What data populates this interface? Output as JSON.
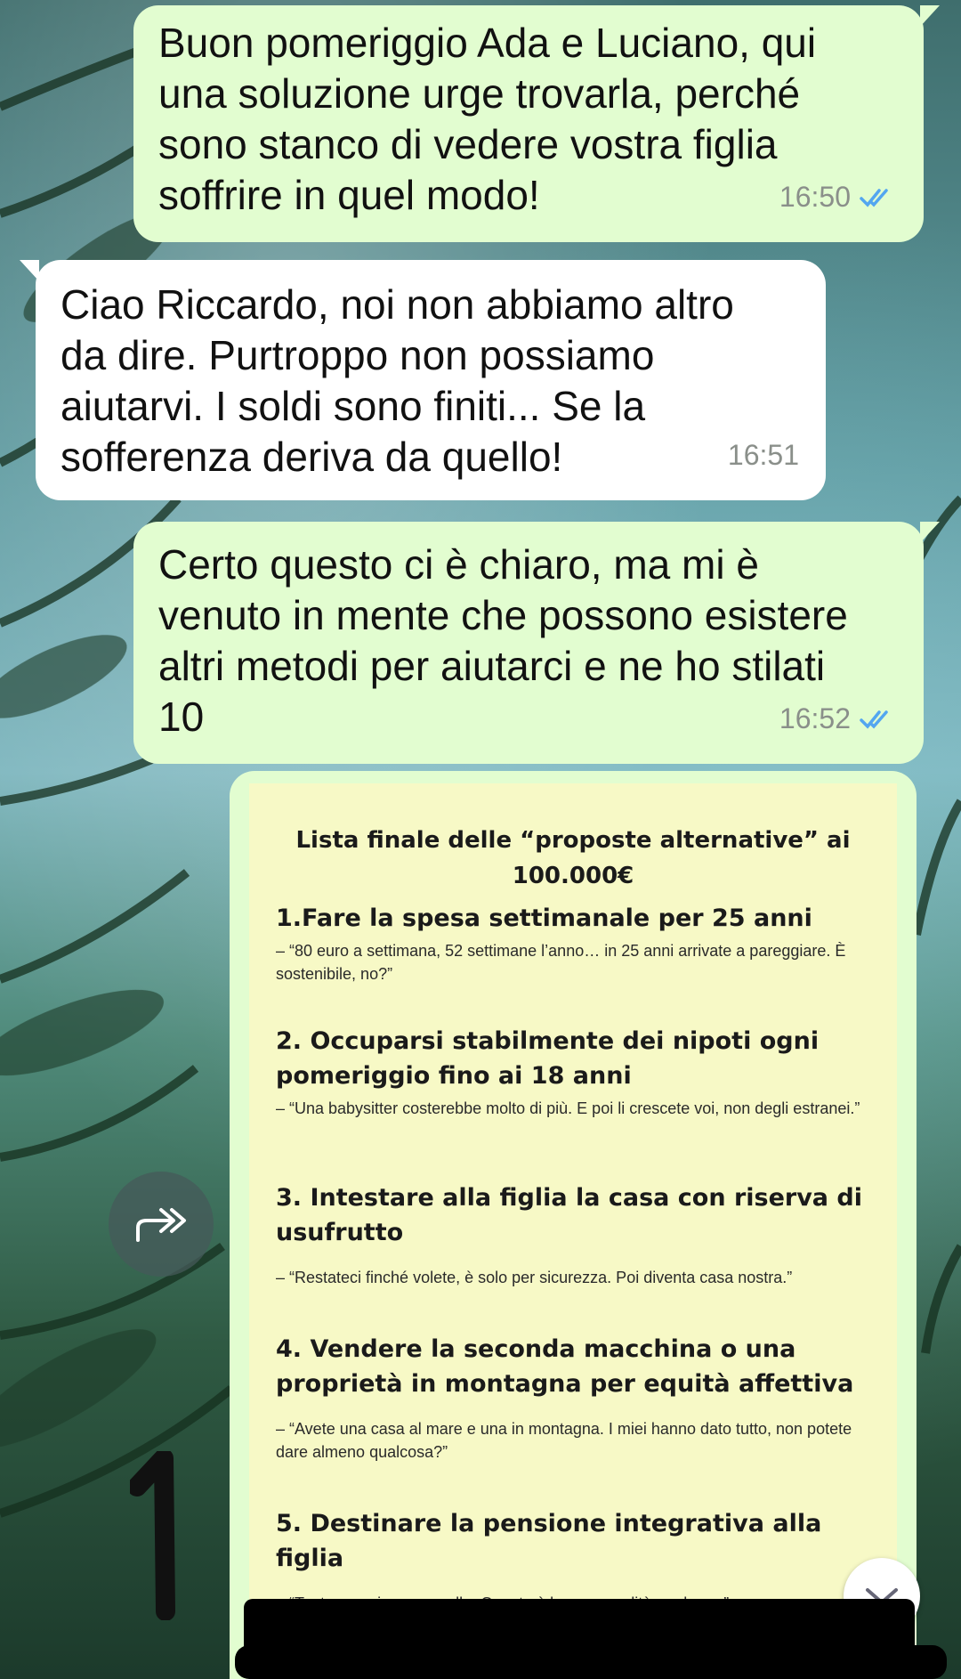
{
  "chat": {
    "messages": [
      {
        "direction": "outgoing",
        "text": "Buon pomeriggio Ada e Luciano, qui\nuna soluzione urge trovarla, perché\nsono stanco di vedere vostra figlia\nsoffrire in quel modo!",
        "time": "16:50",
        "read": true
      },
      {
        "direction": "incoming",
        "text": "Ciao Riccardo, noi non abbiamo altro\nda dire. Purtroppo non possiamo\naiutarvi. I soldi sono finiti... Se la\nsofferenza deriva da quello!",
        "time": "16:51"
      },
      {
        "direction": "outgoing",
        "text": "Certo questo ci è chiaro, ma mi è\nvenuto in mente che possono esistere\naltri metodi per aiutarci e ne ho stilati\n10",
        "time": "16:52",
        "read": true
      }
    ],
    "image_message": {
      "title_line1": "Lista finale delle “proposte alternative” ai",
      "title_line2": "100.000€",
      "items": [
        {
          "heading": "1.Fare la spesa settimanale per 25 anni",
          "quote": "– “80 euro a settimana, 52 settimane l’anno… in 25 anni arrivate a pareggiare. È sostenibile, no?”"
        },
        {
          "heading": "2. Occuparsi stabilmente dei nipoti ogni pomeriggio fino ai 18 anni",
          "quote": "– “Una babysitter costerebbe molto di più. E poi li crescete voi, non degli estranei.”"
        },
        {
          "heading": "3. Intestare alla figlia la casa con riserva di usufrutto",
          "quote": "– “Restateci finché volete, è solo per sicurezza. Poi diventa casa nostra.”"
        },
        {
          "heading": "4. Vendere la seconda macchina o una proprietà in montagna per equità affettiva",
          "quote": "– “Avete una casa al mare e una in montagna. I miei hanno dato tutto, non potete dare almeno qualcosa?”"
        },
        {
          "heading": "5. Destinare la pensione integrativa alla figlia",
          "quote": "– “Tanto non vi manca nulla. Questa è la vera eredità moderna.”"
        }
      ]
    }
  },
  "icons": {
    "read_receipt": "double-check-icon",
    "forward": "forward-icon",
    "scroll_down": "chevron-down-icon"
  },
  "colors": {
    "outgoing_bubble": "#e2fdd0",
    "incoming_bubble": "#ffffff",
    "read_tick": "#53a6f0",
    "document_bg": "#f7f9c6"
  }
}
